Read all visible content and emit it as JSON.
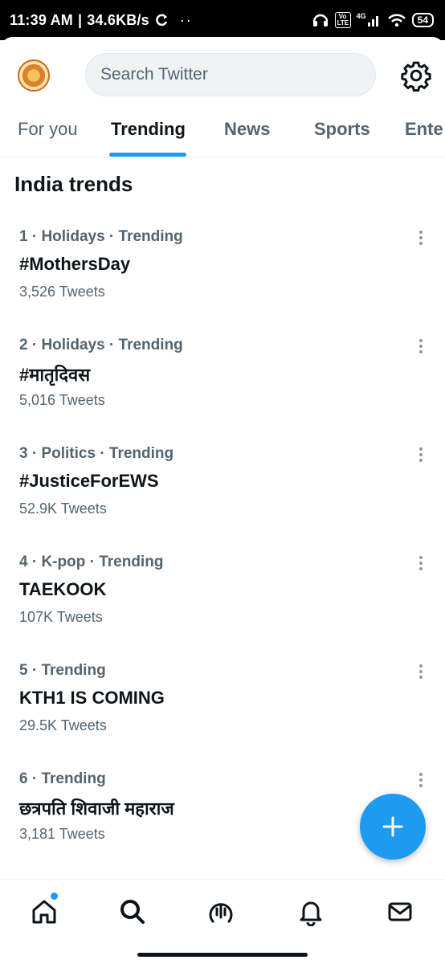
{
  "status_bar": {
    "time": "11:39 AM",
    "network_speed": "34.6KB/s",
    "network_type": "4G",
    "volte": "Vo LTE",
    "battery": "54"
  },
  "header": {
    "search_placeholder": "Search Twitter",
    "logo_icon": "profile-avatar",
    "settings_icon": "gear-icon"
  },
  "tabs": [
    {
      "label": "For you"
    },
    {
      "label": "Trending",
      "active": true
    },
    {
      "label": "News"
    },
    {
      "label": "Sports"
    },
    {
      "label": "Ente"
    }
  ],
  "section_title": "India trends",
  "trends": [
    {
      "meta": "1 · Holidays · Trending",
      "name": "#MothersDay",
      "count": "3,526 Tweets"
    },
    {
      "meta": "2 · Holidays · Trending",
      "name": "#मातृदिवस",
      "count": "5,016 Tweets"
    },
    {
      "meta": "3 · Politics · Trending",
      "name": "#JusticeForEWS",
      "count": "52.9K Tweets"
    },
    {
      "meta": "4 · K-pop · Trending",
      "name": "TAEKOOK",
      "count": "107K Tweets"
    },
    {
      "meta": "5 · Trending",
      "name": "KTH1 IS COMING",
      "count": "29.5K Tweets"
    },
    {
      "meta": "6 · Trending",
      "name": "छत्रपति शिवाजी महाराज",
      "count": "3,181 Tweets"
    }
  ],
  "bottom_nav": [
    {
      "icon": "home-icon",
      "has_badge": true
    },
    {
      "icon": "search-icon"
    },
    {
      "icon": "spaces-icon"
    },
    {
      "icon": "notifications-icon"
    },
    {
      "icon": "messages-icon"
    }
  ],
  "colors": {
    "accent": "#1d9bf0",
    "text_primary": "#0f1419",
    "text_secondary": "#536471"
  }
}
